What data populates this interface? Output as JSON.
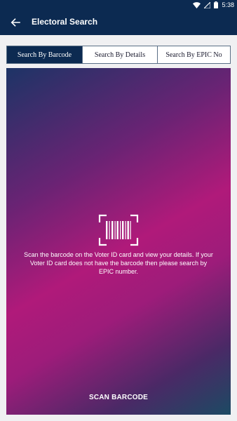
{
  "status_bar": {
    "time": "5:38",
    "icons": [
      "wifi-icon",
      "signal-icon",
      "battery-icon"
    ]
  },
  "app_bar": {
    "title": "Electoral Search",
    "back_icon": "arrow-left-icon"
  },
  "tabs": [
    {
      "label": "Search By Barcode",
      "active": true
    },
    {
      "label": "Search By Details",
      "active": false
    },
    {
      "label": "Search By EPIC No",
      "active": false
    }
  ],
  "scan_panel": {
    "icon": "barcode-scan-icon",
    "description": "Scan the barcode on the Voter ID card and view your details. If your Voter ID card does not have the barcode then please search by EPIC number.",
    "button_label": "SCAN BARCODE"
  },
  "colors": {
    "primary": "#0c2a51",
    "gradient_pink": "#b01a7a",
    "gradient_navy": "#1d3466",
    "gradient_teal": "#1c4a63"
  }
}
